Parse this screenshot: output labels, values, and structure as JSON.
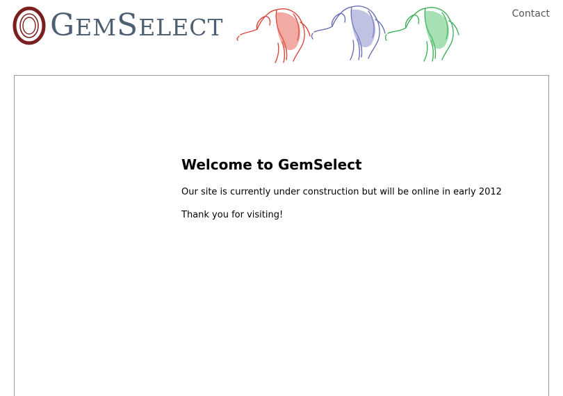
{
  "header": {
    "logo": {
      "brand_text_first": "G",
      "brand_text_em": "em",
      "brand_text_second": "S",
      "brand_text_elect": "elect",
      "brand_name": "GemSelect"
    },
    "elephant_colors": [
      "#d9463a",
      "#6a6fb3",
      "#3db05a"
    ],
    "contact_label": "Contact"
  },
  "main": {
    "heading": "Welcome to GemSelect",
    "message": "Our site is currently under construction but will be online in early 2012",
    "thanks": "Thank you for visiting!"
  },
  "colors": {
    "logo_text": "#4d5f73",
    "logo_ring": "#7a1f1f",
    "contact": "#555555",
    "border": "#9a9a9a"
  }
}
